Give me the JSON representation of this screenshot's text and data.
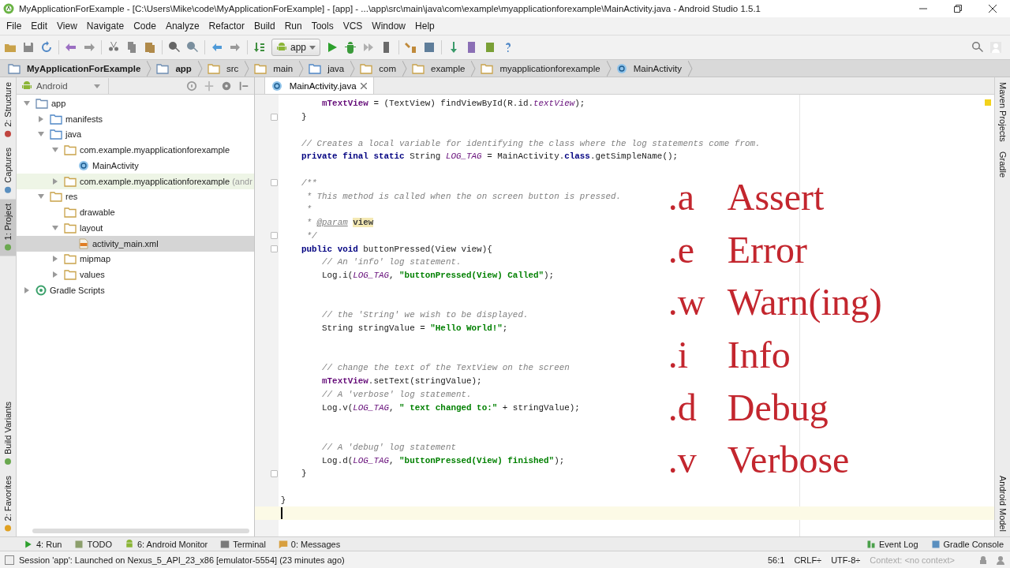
{
  "window": {
    "title": "MyApplicationForExample - [C:\\Users\\Mike\\code\\MyApplicationForExample] - [app] - ...\\app\\src\\main\\java\\com\\example\\myapplicationforexample\\MainActivity.java - Android Studio 1.5.1"
  },
  "menu": [
    "File",
    "Edit",
    "View",
    "Navigate",
    "Code",
    "Analyze",
    "Refactor",
    "Build",
    "Run",
    "Tools",
    "VCS",
    "Window",
    "Help"
  ],
  "toolbar": {
    "run_config": "app"
  },
  "breadcrumbs": [
    {
      "label": "MyApplicationForExample",
      "kind": "module"
    },
    {
      "label": "app",
      "kind": "module"
    },
    {
      "label": "src",
      "kind": "folder"
    },
    {
      "label": "main",
      "kind": "folder"
    },
    {
      "label": "java",
      "kind": "source"
    },
    {
      "label": "com",
      "kind": "package"
    },
    {
      "label": "example",
      "kind": "package"
    },
    {
      "label": "myapplicationforexample",
      "kind": "package"
    },
    {
      "label": "MainActivity",
      "kind": "class"
    }
  ],
  "left_tool_tabs": {
    "top": [
      {
        "label": "2: Structure",
        "selected": false
      },
      {
        "label": "Captures",
        "selected": false
      },
      {
        "label": "1: Project",
        "selected": true
      }
    ],
    "bottom": [
      {
        "label": "Build Variants",
        "selected": false
      },
      {
        "label": "2: Favorites",
        "selected": false
      }
    ]
  },
  "project_panel": {
    "view": "Android",
    "tree": [
      {
        "label": "app",
        "kind": "module",
        "expanded": true,
        "selected": false,
        "highlighted": false,
        "children": [
          {
            "label": "manifests",
            "kind": "source",
            "expanded": false,
            "selected": false,
            "highlighted": false
          },
          {
            "label": "java",
            "kind": "source",
            "expanded": true,
            "selected": false,
            "highlighted": false,
            "children": [
              {
                "label": "com.example.myapplicationforexample",
                "kind": "package",
                "expanded": true,
                "selected": false,
                "highlighted": false,
                "children": [
                  {
                    "label": "MainActivity",
                    "kind": "class",
                    "selected": false,
                    "highlighted": false
                  }
                ]
              },
              {
                "label": "com.example.myapplicationforexample",
                "suffix": "(andr",
                "kind": "package",
                "expanded": false,
                "selected": false,
                "highlighted": true
              }
            ]
          },
          {
            "label": "res",
            "kind": "res",
            "expanded": true,
            "selected": false,
            "highlighted": false,
            "children": [
              {
                "label": "drawable",
                "kind": "package",
                "selected": false,
                "highlighted": false
              },
              {
                "label": "layout",
                "kind": "package",
                "expanded": true,
                "selected": false,
                "highlighted": false,
                "children": [
                  {
                    "label": "activity_main.xml",
                    "kind": "xml",
                    "selected": true,
                    "highlighted": false
                  }
                ]
              },
              {
                "label": "mipmap",
                "kind": "package",
                "expanded": false,
                "selected": false,
                "highlighted": false
              },
              {
                "label": "values",
                "kind": "package",
                "expanded": false,
                "selected": false,
                "highlighted": false
              }
            ]
          }
        ]
      },
      {
        "label": "Gradle Scripts",
        "kind": "gradle",
        "expanded": false,
        "selected": false,
        "highlighted": false
      }
    ]
  },
  "editor": {
    "tabs": [
      {
        "label": "MainActivity.java",
        "selected": true
      }
    ],
    "lines": [
      {
        "kind": "code",
        "current": false,
        "fold": false,
        "segs": [
          {
            "kind": "field",
            "text": "        mTextView"
          },
          {
            "kind": "plain",
            "text": " = (TextView) findViewById(R.id."
          },
          {
            "kind": "static",
            "text": "textView"
          },
          {
            "kind": "plain",
            "text": ");"
          }
        ]
      },
      {
        "kind": "code",
        "current": false,
        "fold": true,
        "segs": [
          {
            "kind": "plain",
            "text": "    }"
          }
        ]
      },
      {
        "kind": "blank",
        "current": false,
        "fold": false
      },
      {
        "kind": "code",
        "current": false,
        "fold": false,
        "segs": [
          {
            "kind": "comment",
            "text": "    // Creates a local variable for identifying the class where the log statements come from."
          }
        ]
      },
      {
        "kind": "code",
        "current": false,
        "fold": false,
        "segs": [
          {
            "kind": "keyword",
            "text": "    private final static "
          },
          {
            "kind": "plain",
            "text": "String "
          },
          {
            "kind": "static",
            "text": "LOG_TAG"
          },
          {
            "kind": "plain",
            "text": " = MainActivity."
          },
          {
            "kind": "keyword",
            "text": "class"
          },
          {
            "kind": "plain",
            "text": ".getSimpleName();"
          }
        ]
      },
      {
        "kind": "blank",
        "current": false,
        "fold": false
      },
      {
        "kind": "code",
        "current": false,
        "fold": true,
        "segs": [
          {
            "kind": "doc",
            "text": "    /**"
          }
        ]
      },
      {
        "kind": "code",
        "current": false,
        "fold": false,
        "segs": [
          {
            "kind": "doc",
            "text": "     * This method is called when the on screen button is pressed."
          }
        ]
      },
      {
        "kind": "code",
        "current": false,
        "fold": false,
        "segs": [
          {
            "kind": "doc",
            "text": "     *"
          }
        ]
      },
      {
        "kind": "code",
        "current": false,
        "fold": false,
        "segs": [
          {
            "kind": "doc",
            "text": "     * "
          },
          {
            "kind": "doc-tag",
            "text": "@param"
          },
          {
            "kind": "param",
            "text": "view"
          }
        ]
      },
      {
        "kind": "code",
        "current": false,
        "fold": true,
        "segs": [
          {
            "kind": "doc",
            "text": "     */"
          }
        ]
      },
      {
        "kind": "code",
        "current": false,
        "fold": true,
        "segs": [
          {
            "kind": "keyword",
            "text": "    public void "
          },
          {
            "kind": "plain",
            "text": "buttonPressed(View view){"
          }
        ]
      },
      {
        "kind": "code",
        "current": false,
        "fold": false,
        "segs": [
          {
            "kind": "comment",
            "text": "        // An 'info' log statement."
          }
        ]
      },
      {
        "kind": "code",
        "current": false,
        "fold": false,
        "segs": [
          {
            "kind": "plain",
            "text": "        Log.i("
          },
          {
            "kind": "static",
            "text": "LOG_TAG"
          },
          {
            "kind": "plain",
            "text": ", "
          },
          {
            "kind": "string",
            "text": "\"buttonPressed(View) Called\""
          },
          {
            "kind": "plain",
            "text": ");"
          }
        ]
      },
      {
        "kind": "blank",
        "current": false,
        "fold": false
      },
      {
        "kind": "blank",
        "current": false,
        "fold": false
      },
      {
        "kind": "code",
        "current": false,
        "fold": false,
        "segs": [
          {
            "kind": "comment",
            "text": "        // the 'String' we wish to be displayed."
          }
        ]
      },
      {
        "kind": "code",
        "current": false,
        "fold": false,
        "segs": [
          {
            "kind": "plain",
            "text": "        String stringValue = "
          },
          {
            "kind": "string",
            "text": "\"Hello World!\""
          },
          {
            "kind": "plain",
            "text": ";"
          }
        ]
      },
      {
        "kind": "blank",
        "current": false,
        "fold": false
      },
      {
        "kind": "blank",
        "current": false,
        "fold": false
      },
      {
        "kind": "code",
        "current": false,
        "fold": false,
        "segs": [
          {
            "kind": "comment",
            "text": "        // change the text of the TextView on the screen"
          }
        ]
      },
      {
        "kind": "code",
        "current": false,
        "fold": false,
        "segs": [
          {
            "kind": "field",
            "text": "        mTextView"
          },
          {
            "kind": "plain",
            "text": ".setText(stringValue);"
          }
        ]
      },
      {
        "kind": "code",
        "current": false,
        "fold": false,
        "segs": [
          {
            "kind": "comment",
            "text": "        // A 'verbose' log statement."
          }
        ]
      },
      {
        "kind": "code",
        "current": false,
        "fold": false,
        "segs": [
          {
            "kind": "plain",
            "text": "        Log.v("
          },
          {
            "kind": "static",
            "text": "LOG_TAG"
          },
          {
            "kind": "plain",
            "text": ", "
          },
          {
            "kind": "string",
            "text": "\" text changed to:\""
          },
          {
            "kind": "plain",
            "text": " + stringValue);"
          }
        ]
      },
      {
        "kind": "blank",
        "current": false,
        "fold": false
      },
      {
        "kind": "blank",
        "current": false,
        "fold": false
      },
      {
        "kind": "code",
        "current": false,
        "fold": false,
        "segs": [
          {
            "kind": "comment",
            "text": "        // A 'debug' log statement"
          }
        ]
      },
      {
        "kind": "code",
        "current": false,
        "fold": false,
        "segs": [
          {
            "kind": "plain",
            "text": "        Log.d("
          },
          {
            "kind": "static",
            "text": "LOG_TAG"
          },
          {
            "kind": "plain",
            "text": ", "
          },
          {
            "kind": "string",
            "text": "\"buttonPressed(View) finished\""
          },
          {
            "kind": "plain",
            "text": ");"
          }
        ]
      },
      {
        "kind": "code",
        "current": false,
        "fold": true,
        "segs": [
          {
            "kind": "plain",
            "text": "    }"
          }
        ]
      },
      {
        "kind": "blank",
        "current": false,
        "fold": false
      },
      {
        "kind": "code",
        "current": false,
        "fold": false,
        "segs": [
          {
            "kind": "plain",
            "text": "}"
          }
        ]
      },
      {
        "kind": "blank",
        "current": true,
        "fold": false
      }
    ],
    "overlay": [
      {
        "key": ".a",
        "label": "Assert"
      },
      {
        "key": ".e",
        "label": "Error"
      },
      {
        "key": ".w",
        "label": "Warn(ing)"
      },
      {
        "key": ".i",
        "label": "Info"
      },
      {
        "key": ".d",
        "label": "Debug"
      },
      {
        "key": ".v",
        "label": "Verbose"
      }
    ]
  },
  "right_tool_tabs": {
    "top": [
      "Maven Projects",
      "Gradle"
    ],
    "bottom": [
      "Android Model"
    ]
  },
  "bottom_tool_tabs": {
    "left": [
      "4: Run",
      "TODO",
      "6: Android Monitor",
      "Terminal",
      "0: Messages"
    ],
    "right": [
      "Event Log",
      "Gradle Console"
    ]
  },
  "status_bar": {
    "message": "Session 'app': Launched on Nexus_5_API_23_x86 [emulator-5554] (23 minutes ago)",
    "position": "56:1",
    "line_separator": "CRLF÷",
    "encoding": "UTF-8÷",
    "context": "Context: <no context>"
  }
}
